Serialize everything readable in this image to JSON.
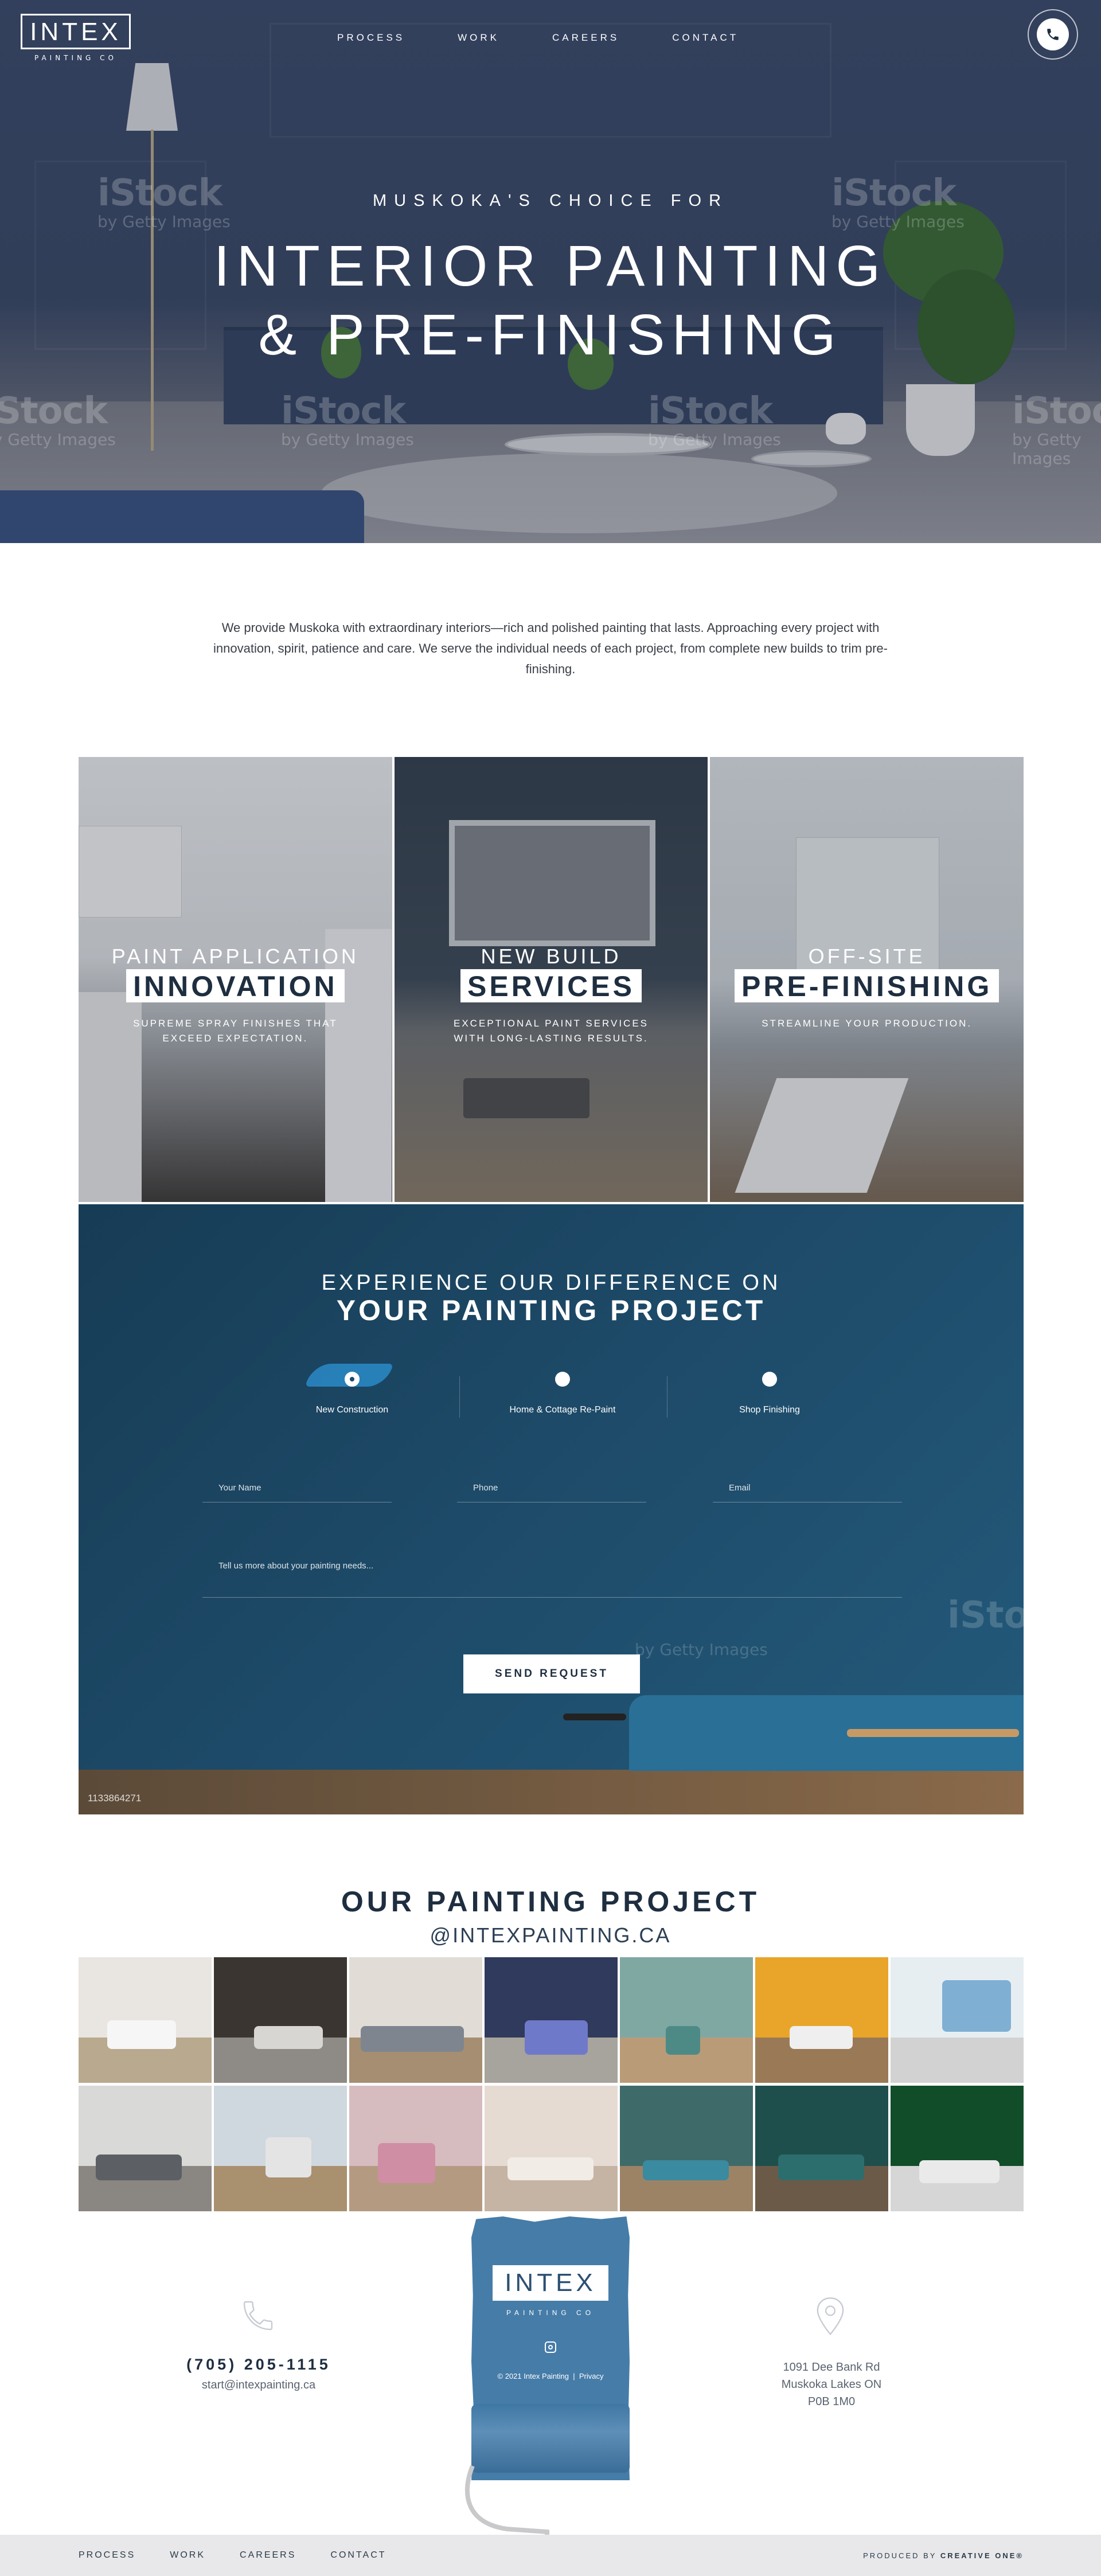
{
  "brand": {
    "logo_text": "INTEX",
    "logo_sub": "PAINTING CO"
  },
  "nav": {
    "items": [
      "PROCESS",
      "WORK",
      "CAREERS",
      "CONTACT"
    ]
  },
  "hero": {
    "kicker": "MUSKOKA'S CHOICE FOR",
    "title_line1": "INTERIOR PAINTING",
    "title_line2": "& PRE-FINISHING",
    "watermark": "iStock",
    "watermark_sub": "by Getty Images"
  },
  "intro": "We provide Muskoka with extraordinary interiors—rich and polished painting that lasts. Approaching every project with innovation, spirit, patience and care. We serve the individual needs of each project, from complete new builds to trim pre-finishing.",
  "services": [
    {
      "small": "PAINT APPLICATION",
      "big": "INNOVATION",
      "desc": "SUPREME SPRAY FINISHES THAT EXCEED EXPECTATION."
    },
    {
      "small": "NEW BUILD",
      "big": "SERVICES",
      "desc": "EXCEPTIONAL PAINT SERVICES WITH LONG-LASTING RESULTS."
    },
    {
      "small": "OFF-SITE",
      "big": "PRE-FINISHING",
      "desc": "STREAMLINE YOUR PRODUCTION."
    }
  ],
  "contact": {
    "heading_line1": "EXPERIENCE OUR DIFFERENCE ON",
    "heading_line2": "YOUR PAINTING PROJECT",
    "options": [
      "New Construction",
      "Home & Cottage Re-Paint",
      "Shop Finishing"
    ],
    "selected_option": "New Construction",
    "fields": {
      "name": "Your Name",
      "phone": "Phone",
      "email": "Email",
      "message": "Tell us more about your painting needs..."
    },
    "submit_label": "SEND REQUEST",
    "image_id": "1133864271"
  },
  "gallery": {
    "title": "OUR PAINTING PROJECT",
    "handle": "@INTEXPAINTING.CA"
  },
  "footer": {
    "phone": "(705) 205-1115",
    "email": "start@intexpainting.ca",
    "address_line1": "1091 Dee Bank Rd",
    "address_line2": "Muskoka Lakes ON",
    "address_line3": "P0B 1M0",
    "copyright": "© 2021 Intex Painting",
    "privacy": "Privacy",
    "produced_by_label": "PRODUCED BY",
    "produced_by_name": "CREATIVE ONE®"
  },
  "colors": {
    "navy": "#1e2e40",
    "contact_bg": "#1d4a68",
    "roller_blue": "#467ca8",
    "accent_stroke": "#2a86c2"
  }
}
